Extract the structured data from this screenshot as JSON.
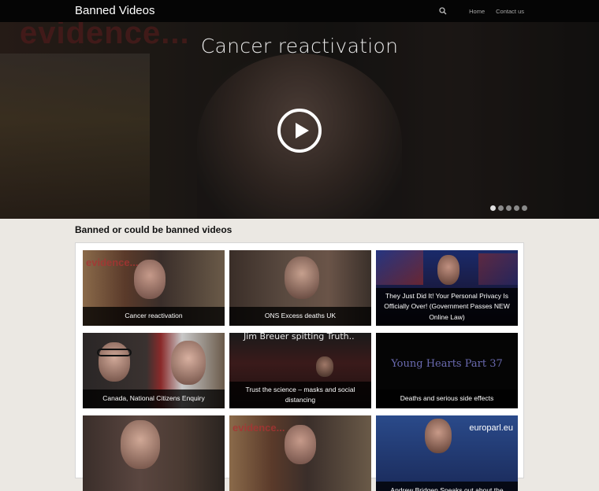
{
  "header": {
    "brand": "Banned Videos",
    "nav": {
      "home": "Home",
      "contact": "Contact us"
    }
  },
  "hero": {
    "title": "Cancer reactivation",
    "bg_text": "evidence...",
    "slides_total": 5,
    "active_slide": 1
  },
  "section": {
    "title": "Banned or could be banned videos"
  },
  "videos": [
    {
      "caption": "Cancer reactivation",
      "thumb_text": "evidence..."
    },
    {
      "caption": "ONS Excess deaths UK",
      "thumb_text": ""
    },
    {
      "caption": "They Just Did It! Your Personal Privacy Is Officially Over! (Government Passes NEW Online Law)",
      "thumb_text": ""
    },
    {
      "caption": "Canada, National Citizens Enquiry",
      "thumb_text": ""
    },
    {
      "caption": "Trust the science – masks and social distancing",
      "thumb_text": "Jim Breuer spitting Truth.."
    },
    {
      "caption": "Deaths and serious side effects",
      "thumb_text": "Young Hearts Part 37"
    },
    {
      "caption": "",
      "thumb_text": ""
    },
    {
      "caption": "",
      "thumb_text": "evidence..."
    },
    {
      "caption": "Andrew Bridgen Speaks out about the",
      "thumb_text": "europarl.eu"
    }
  ],
  "colors": {
    "topbar": "#050505",
    "page_bg": "#ebe8e3",
    "caption_bg": "#000000"
  }
}
